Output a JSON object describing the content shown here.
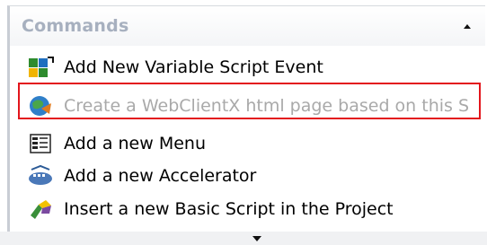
{
  "panel": {
    "title": "Commands",
    "collapse_icon": "chevron-up-icon"
  },
  "commands": [
    {
      "label": "Add New Variable Script Event",
      "icon": "variable-script-event-icon",
      "enabled": true
    },
    {
      "label": "Create a WebClientX html page based on this S",
      "icon": "webclientx-page-icon",
      "enabled": false
    },
    {
      "label": "Add a new Menu",
      "icon": "menu-icon",
      "enabled": true
    },
    {
      "label": "Add a new Accelerator",
      "icon": "accelerator-icon",
      "enabled": true
    },
    {
      "label": "Insert a new Basic Script in the Project",
      "icon": "basic-script-icon",
      "enabled": true
    }
  ],
  "highlight_color": "#e3151c",
  "more_icon": "chevron-down-icon"
}
